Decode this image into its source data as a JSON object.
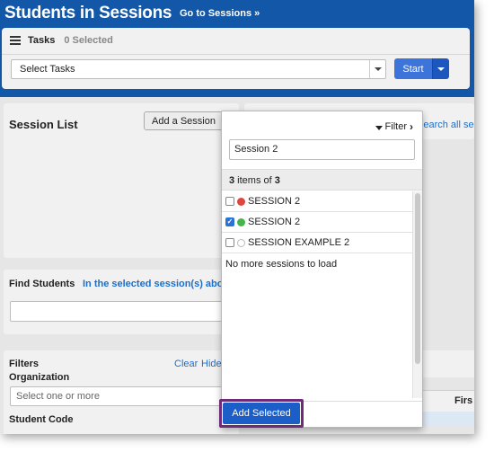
{
  "header": {
    "title": "Students in Sessions",
    "goto_link": "Go to Sessions »"
  },
  "tasks": {
    "label": "Tasks",
    "selected_count": "0 Selected",
    "select_value": "Select Tasks",
    "start_label": "Start"
  },
  "session_list": {
    "title": "Session List",
    "add_button": "Add a Session"
  },
  "right_panel": {
    "search_link": "Search all ses"
  },
  "find_students": {
    "title": "Find Students",
    "scope": "In the selected session(s) above"
  },
  "filters": {
    "title": "Filters",
    "clear": "Clear",
    "hide": "Hide",
    "organization_label": "Organization",
    "organization_placeholder": "Select one or more",
    "student_code_label": "Student Code"
  },
  "results": {
    "first_header": "Firs"
  },
  "dropdown": {
    "filter_label": "Filter",
    "search_value": "Session 2",
    "count_shown": "3",
    "count_mid": " items of ",
    "count_total": "3",
    "items": [
      {
        "label": "SESSION 2",
        "checked": false,
        "status_color": "#e0453b"
      },
      {
        "label": "SESSION 2",
        "checked": true,
        "status_color": "#45b549"
      },
      {
        "label": "SESSION EXAMPLE 2",
        "checked": false,
        "status_color": "#ffffff"
      }
    ],
    "no_more": "No more sessions to load",
    "add_selected": "Add Selected"
  },
  "colors": {
    "header_bg": "#1358a8",
    "accent_blue": "#1b5ec8",
    "highlight_border": "#6f2a7a",
    "link_blue": "#1d6fc9"
  }
}
